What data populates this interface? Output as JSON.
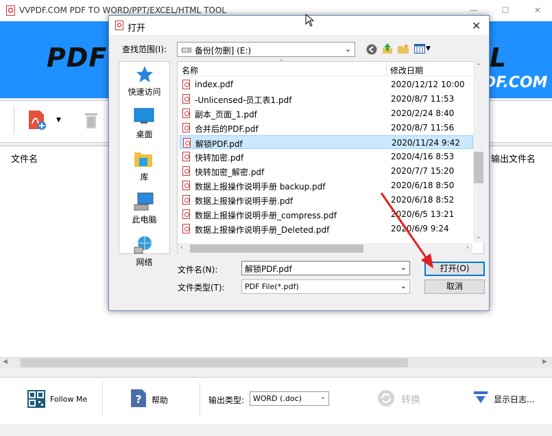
{
  "app": {
    "title": "VVPDF.COM PDF TO WORD/PPT/EXCEL/HTML TOOL",
    "banner_text": "PDF T",
    "banner_text_tail": "L",
    "banner_url": "DF.COM",
    "columns": {
      "filename": "文件名",
      "output_filename": "输出文件名"
    }
  },
  "bottom": {
    "follow_label": "Follow Me",
    "help_label": "帮助",
    "output_type_label": "输出类型:",
    "output_type_value": "WORD (.doc)",
    "convert_label": "转换",
    "log_label": "显示日志..."
  },
  "dialog": {
    "title": "打开",
    "look_in_label": "查找范围(I):",
    "look_in_value": "备份[勿删] (E:)",
    "places": [
      {
        "label": "快速访问"
      },
      {
        "label": "桌面"
      },
      {
        "label": "库"
      },
      {
        "label": "此电脑"
      },
      {
        "label": "网络"
      }
    ],
    "header_name": "名称",
    "header_date": "修改日期",
    "files": [
      {
        "name": "index.pdf",
        "date": "2020/12/12 10:00"
      },
      {
        "name": "-Unlicensed-员工表1.pdf",
        "date": "2020/8/7 11:53"
      },
      {
        "name": "副本_页面_1.pdf",
        "date": "2020/2/24 8:40"
      },
      {
        "name": "合并后的PDF.pdf",
        "date": "2020/8/7 11:56"
      },
      {
        "name": "解锁PDF.pdf",
        "date": "2020/11/24 9:42"
      },
      {
        "name": "快转加密.pdf",
        "date": "2020/4/16 8:53"
      },
      {
        "name": "快转加密_解密.pdf",
        "date": "2020/7/7 15:20"
      },
      {
        "name": "数据上报操作说明手册 backup.pdf",
        "date": "2020/6/18 8:50"
      },
      {
        "name": "数据上报操作说明手册.pdf",
        "date": "2020/6/18 8:52"
      },
      {
        "name": "数据上报操作说明手册_compress.pdf",
        "date": "2020/6/5 13:21"
      },
      {
        "name": "数据上报操作说明手册_Deleted.pdf",
        "date": "2020/6/9 9:24"
      }
    ],
    "filename_label": "文件名(N):",
    "filename_value": "解锁PDF.pdf",
    "filetype_label": "文件类型(T):",
    "filetype_value": "PDF File(*.pdf)",
    "open_label": "打开(O)",
    "cancel_label": "取消"
  },
  "colors": {
    "banner": "#1e90ff",
    "selection": "#cce8ff",
    "arrow": "#e02020"
  }
}
